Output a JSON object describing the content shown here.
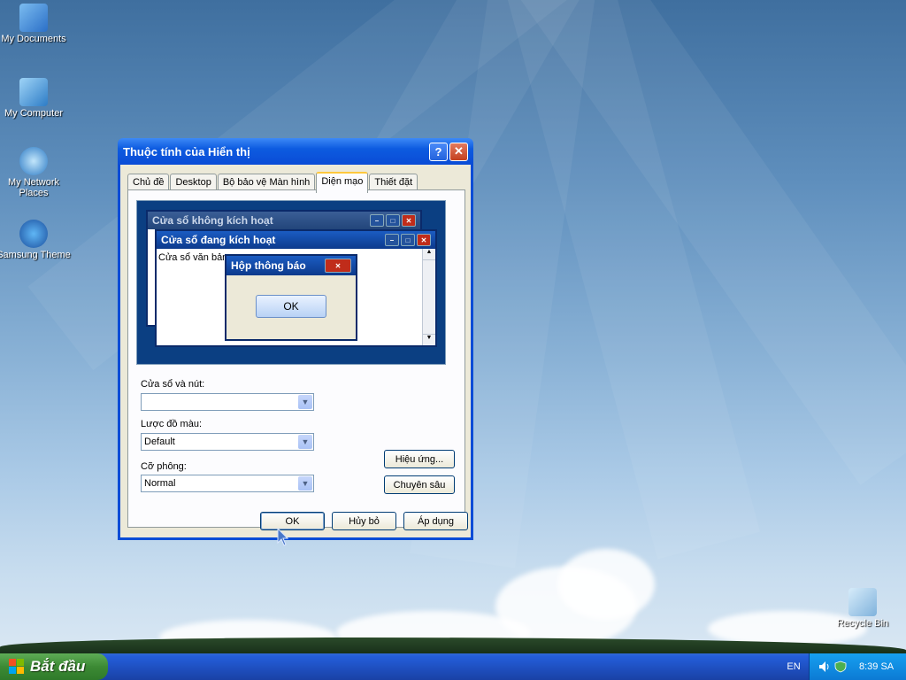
{
  "desktop": {
    "icons": [
      {
        "label": "My Documents",
        "icon": "my-documents-icon"
      },
      {
        "label": "My Computer",
        "icon": "my-computer-icon"
      },
      {
        "label": "My Network Places",
        "icon": "network-places-icon"
      },
      {
        "label": "Samsung Theme",
        "icon": "samsung-theme-icon"
      },
      {
        "label": "Recycle Bin",
        "icon": "recycle-bin-icon"
      }
    ]
  },
  "dialog": {
    "title": "Thuộc tính của Hiển thị",
    "help_button": "?",
    "close_button": "✕",
    "tabs": [
      "Chủ đề",
      "Desktop",
      "Bộ bảo vệ Màn hình",
      "Diện mạo",
      "Thiết đặt"
    ],
    "active_tab": "Diện mạo",
    "preview": {
      "inactive_title": "Cửa sổ không kích hoạt",
      "active_title": "Cửa sổ đang kích hoạt",
      "window_text": "Cửa sổ văn bản",
      "message_title": "Hộp thông báo",
      "message_ok": "OK"
    },
    "windows_buttons_label": "Cửa sổ và nút:",
    "windows_buttons_value": "",
    "color_scheme_label": "Lược đồ màu:",
    "color_scheme_value": "Default",
    "font_size_label": "Cỡ phông:",
    "font_size_value": "Normal",
    "effects_button": "Hiệu ứng...",
    "advanced_button": "Chuyên sâu",
    "ok_button": "OK",
    "cancel_button": "Hủy bỏ",
    "apply_button": "Áp dụng"
  },
  "taskbar": {
    "start_label": "Bắt đầu",
    "language": "EN",
    "clock": "8:39 SA"
  }
}
